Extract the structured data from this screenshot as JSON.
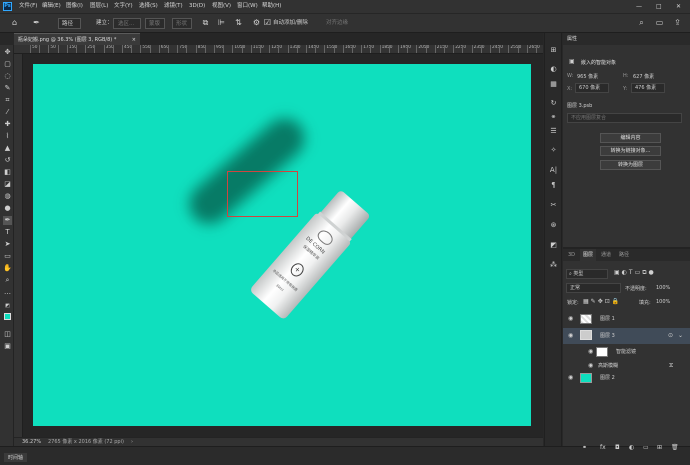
{
  "app": {
    "logo": "Ps"
  },
  "menu": [
    "文件(F)",
    "编辑(E)",
    "图像(I)",
    "图层(L)",
    "文字(Y)",
    "选择(S)",
    "滤镜(T)",
    "3D(D)",
    "视图(V)",
    "窗口(W)",
    "帮助(H)"
  ],
  "window_controls": {
    "minimize": "—",
    "maximize": "□",
    "close": "✕"
  },
  "options": {
    "shape_mode": "路径",
    "make_label": "建立：",
    "selection_btn": "选区...",
    "mask_btn": "蒙版",
    "shape_btn": "形状",
    "auto_add_delete": "自动添加/删除",
    "align_edges": "对齐边缘"
  },
  "document_tab": {
    "title": "瓶朵妃搬.png @ 36.3% (图层 3, RGB/8) *",
    "close": "×"
  },
  "ruler_ticks": [
    "50",
    "0",
    "50",
    "100",
    "150",
    "200",
    "250",
    "300",
    "350",
    "400",
    "450",
    "500",
    "550",
    "600",
    "650",
    "700",
    "750",
    "800",
    "850",
    "900",
    "950",
    "1000",
    "1050",
    "1100",
    "1150",
    "1200",
    "1250",
    "1300",
    "1350",
    "1400",
    "1450",
    "1500",
    "1550",
    "1600",
    "1650",
    "1700",
    "1750",
    "1800",
    "1850",
    "1900",
    "1950",
    "2000",
    "2050",
    "2100",
    "2150",
    "2200",
    "2250",
    "2300",
    "2350",
    "2400",
    "2450",
    "2500",
    "2550",
    "2600",
    "2650",
    "2700",
    "2750"
  ],
  "canvas": {
    "background": "#0fdfbe",
    "bottle_text": "DE CORN",
    "bottle_sub": "保湿精华液",
    "bottle_small": "本品适用于所有肤质",
    "bottle_vol": "30ml"
  },
  "status": {
    "zoom": "36.27%",
    "size": "2765 像素 x 2016 像素 (72 ppi)",
    "arrow": "›"
  },
  "timeline": {
    "label": "时间轴"
  },
  "properties": {
    "title": "属性",
    "object_type": "嵌入的智能对象",
    "w_label": "W:",
    "w": "965 像素",
    "h_label": "H:",
    "h": "627 像素",
    "x_label": "X:",
    "x": "670 像素",
    "y_label": "Y:",
    "y": "476 像素",
    "source_file": "图层 3.psb",
    "comp_placeholder": "不应用图层复合",
    "edit_contents": "编辑内容",
    "convert_linked": "转换为链接对象...",
    "convert_layers": "转换为图层"
  },
  "layers_panel": {
    "tabs": [
      "3D",
      "图层",
      "通道",
      "路径"
    ],
    "filter_kind": "类型",
    "blend_mode": "正常",
    "opacity_label": "不透明度:",
    "opacity": "100%",
    "lock_label": "锁定:",
    "fill_label": "填充:",
    "fill": "100%",
    "layers": [
      {
        "name": "图层 1"
      },
      {
        "name": "图层 3",
        "selected": true
      },
      {
        "name": "智能滤镜"
      },
      {
        "name": "高斯模糊"
      },
      {
        "name": "图层 2"
      }
    ]
  },
  "colors": {
    "accent": "#31a8ff",
    "selection_red": "#d0453f",
    "canvas": "#0fdfbe"
  }
}
